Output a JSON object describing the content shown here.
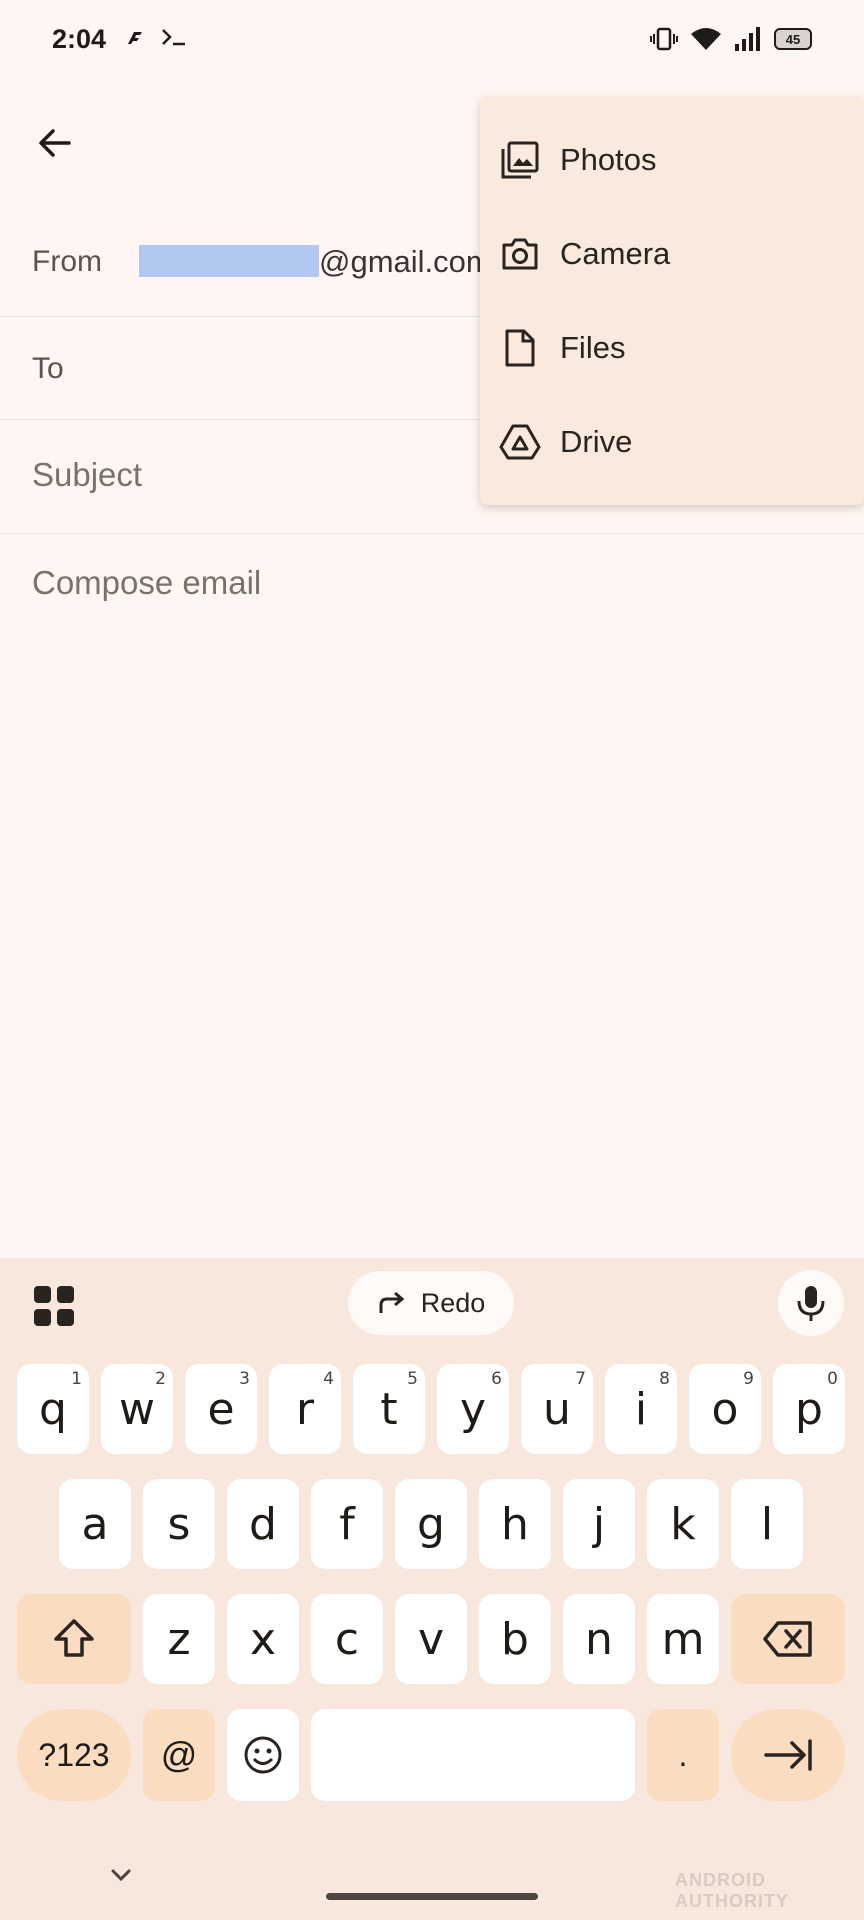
{
  "status_bar": {
    "time": "2:04",
    "battery": "45",
    "icons": [
      "app-notification-icon",
      "terminal-icon",
      "vibrate-icon",
      "wifi-icon",
      "signal-icon",
      "battery-icon"
    ]
  },
  "compose": {
    "from_label": "From",
    "from_email": "@gmail.com",
    "to_label": "To",
    "subject_placeholder": "Subject",
    "body_placeholder": "Compose email"
  },
  "attach_menu": {
    "items": [
      {
        "label": "Photos",
        "icon": "photos-icon"
      },
      {
        "label": "Camera",
        "icon": "camera-icon"
      },
      {
        "label": "Files",
        "icon": "file-icon"
      },
      {
        "label": "Drive",
        "icon": "drive-icon"
      }
    ]
  },
  "keyboard": {
    "redo_label": "Redo",
    "row1": [
      {
        "k": "q",
        "n": "1"
      },
      {
        "k": "w",
        "n": "2"
      },
      {
        "k": "e",
        "n": "3"
      },
      {
        "k": "r",
        "n": "4"
      },
      {
        "k": "t",
        "n": "5"
      },
      {
        "k": "y",
        "n": "6"
      },
      {
        "k": "u",
        "n": "7"
      },
      {
        "k": "i",
        "n": "8"
      },
      {
        "k": "o",
        "n": "9"
      },
      {
        "k": "p",
        "n": "0"
      }
    ],
    "row2": [
      "a",
      "s",
      "d",
      "f",
      "g",
      "h",
      "j",
      "k",
      "l"
    ],
    "row3": [
      "z",
      "x",
      "c",
      "v",
      "b",
      "n",
      "m"
    ],
    "symbols_label": "?123",
    "at_label": "@",
    "period_label": "."
  },
  "watermark": "ANDROID AUTHORITY",
  "colors": {
    "background": "#fff5f2",
    "menu": "#f9eadd",
    "keyboard": "#f8e7dc",
    "modifier_key": "#fadcc0",
    "email_highlight": "#b3c8f0"
  }
}
